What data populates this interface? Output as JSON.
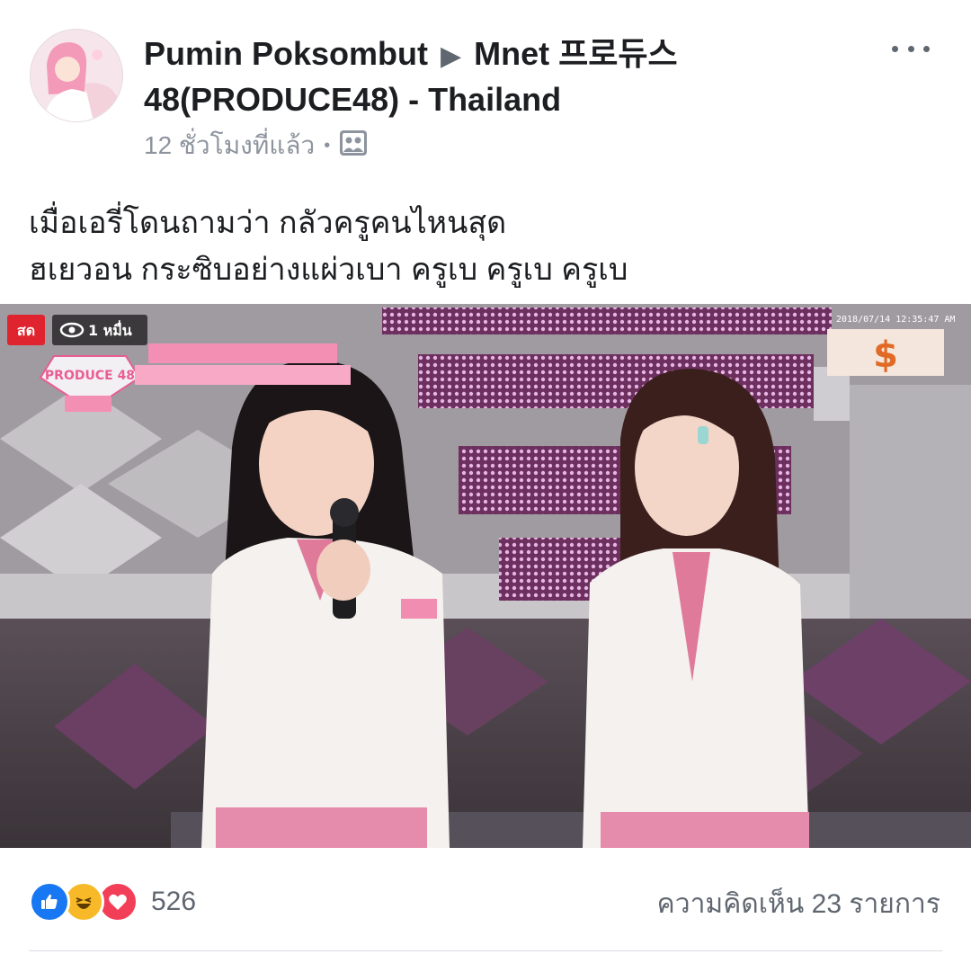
{
  "post": {
    "author": "Pumin Poksombut",
    "group": "Mnet 프로듀스 48(PRODUCE48) - Thailand",
    "arrow": "▶",
    "time": "12 ชั่วโมงที่แล้ว",
    "audience_icon": "group-audience-icon",
    "menu_icon": "more-options-icon",
    "message_lines": [
      "เมื่อเอรี่โดนถามว่า กลัวครูคนไหนสุด",
      "ฮเยวอน กระซิบอย่างแผ่วเบา ครูเบ ครูเบ ครูเบ"
    ]
  },
  "photo": {
    "live_badge": "สด",
    "viewers": "1 หมื่น",
    "show_logo": "PRODUCE 48",
    "timestamp": "2018/07/14 12:35:47 AM",
    "channel_logo": "$"
  },
  "footer": {
    "reaction_icons": [
      "like-icon",
      "haha-icon",
      "love-icon"
    ],
    "reaction_count": "526",
    "comments_label": "ความคิดเห็น 23 รายการ"
  },
  "colors": {
    "like": "#1877f2",
    "haha": "#f7b928",
    "love": "#f33e58",
    "live_red": "#e0242f",
    "produce_pink": "#e95d93"
  }
}
